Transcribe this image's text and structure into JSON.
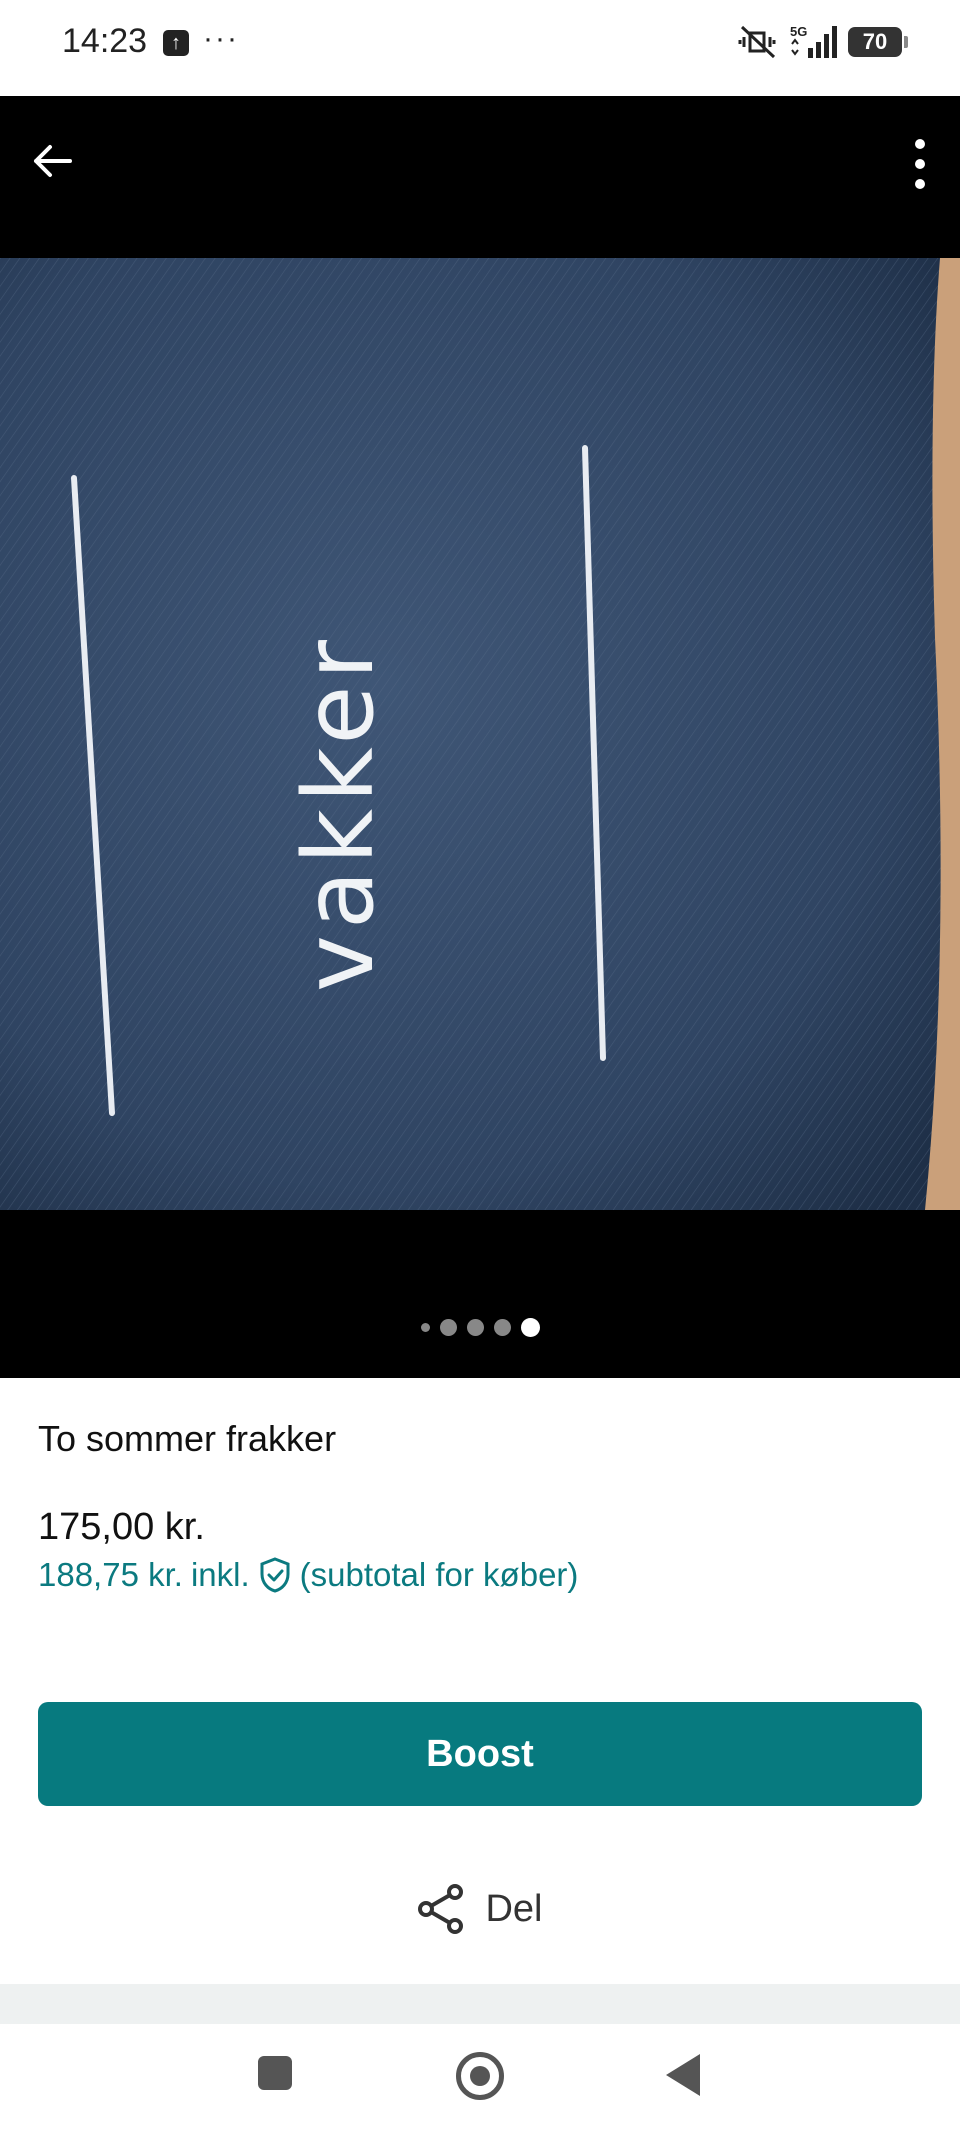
{
  "status_bar": {
    "time": "14:23",
    "network": "5G",
    "battery": "70"
  },
  "listing": {
    "title": "To sommer frakker",
    "price": "175,00 kr.",
    "subtotal_price": "188,75 kr.",
    "subtotal_incl": "inkl.",
    "subtotal_note": "(subtotal for køber)",
    "image_text": "vakker",
    "image_count": 5,
    "active_image_index": 4
  },
  "actions": {
    "boost_label": "Boost",
    "share_label": "Del"
  },
  "colors": {
    "accent": "#077a7f",
    "link": "#0b7a80"
  }
}
